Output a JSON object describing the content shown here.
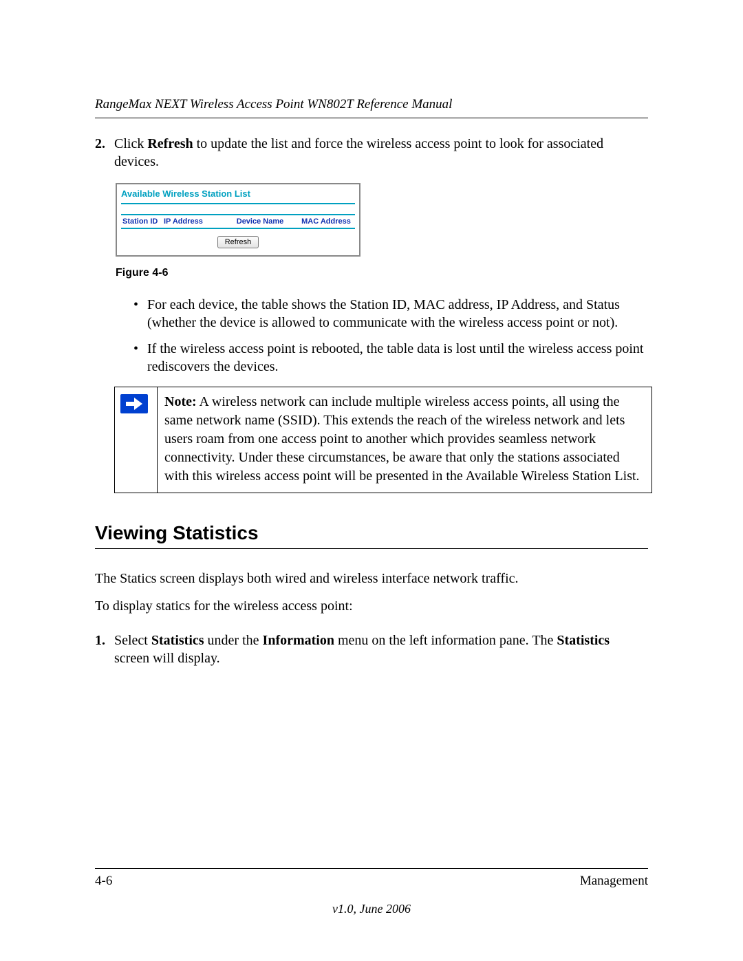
{
  "header": {
    "manual_title": "RangeMax NEXT Wireless Access Point WN802T Reference Manual"
  },
  "step2": {
    "num": "2.",
    "pre": "Click ",
    "b1": "Refresh",
    "post": " to update the list and force the wireless access point to look for associated devices."
  },
  "figure": {
    "panel_title": "Available Wireless Station List",
    "col1": "Station ID",
    "col2": "IP Address",
    "col3": "Device Name",
    "col4": "MAC Address",
    "refresh": "Refresh",
    "caption": "Figure 4-6"
  },
  "bullets": {
    "b1": "For each device, the table shows the Station ID, MAC address, IP Address, and Status (whether the device is allowed to communicate with the wireless access point or not).",
    "b2": "If the wireless access point is rebooted, the table data is lost until the wireless access point rediscovers the devices."
  },
  "note": {
    "label": "Note:",
    "text": " A wireless network can include multiple wireless access points, all using the same network name (SSID). This extends the reach of the wireless network and lets users roam from one access point to another which provides seamless network connectivity. Under these circumstances, be aware that only the stations associated with this wireless access point will be presented in the Available Wireless Station List."
  },
  "section": {
    "heading": "Viewing Statistics",
    "p1": "The Statics screen displays both wired and wireless interface network traffic.",
    "p2": "To display statics for the wireless access point:",
    "step1": {
      "num": "1.",
      "t1": "Select ",
      "b1": "Statistics",
      "t2": " under the ",
      "b2": "Information",
      "t3": " menu on the left information pane. The ",
      "b3": "Statistics",
      "t4": " screen will display."
    }
  },
  "footer": {
    "left": "4-6",
    "right": "Management",
    "version": "v1.0, June 2006"
  }
}
